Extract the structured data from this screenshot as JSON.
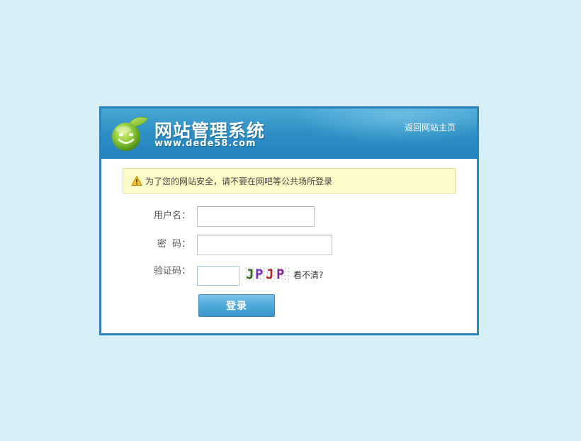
{
  "header": {
    "title": "网站管理系统",
    "url": "www.dede58.com",
    "home_link": "返回网站主页",
    "logo_icon": "smiley-leaf-logo"
  },
  "notice": {
    "icon": "warning-icon",
    "text": "为了您的网站安全，请不要在网吧等公共场所登录"
  },
  "form": {
    "username_label": "用户名：",
    "username_value": "",
    "password_label": "密  码：",
    "password_value": "",
    "captcha_label": "验证码：",
    "captcha_value": "",
    "captcha_image_chars": [
      "J",
      "P",
      "J",
      "P"
    ],
    "captcha_refresh_link": "看不清?",
    "submit_label": "登录"
  },
  "colors": {
    "page_background": "#d6eef6",
    "frame_border": "#2a86b8",
    "header_blue": "#2f91c6",
    "notice_background": "#fdfbc8",
    "button_blue": "#4da8da",
    "captcha_colors": [
      "#2f6b1a",
      "#7a2dbd",
      "#b3262d",
      "#8a1d9a"
    ]
  }
}
